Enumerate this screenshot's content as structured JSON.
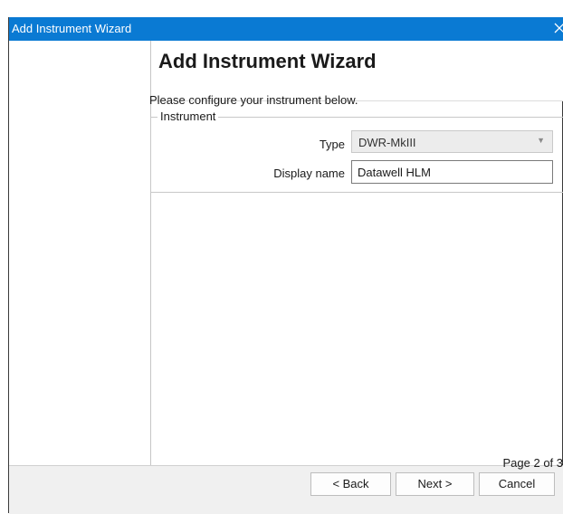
{
  "window": {
    "title": "Add Instrument Wizard",
    "close_glyph": "✕"
  },
  "page": {
    "heading": "Add Instrument Wizard",
    "intro": "Please configure your instrument below.",
    "group_legend": "Instrument",
    "type_label": "Type",
    "type_value": "DWR-MkIII",
    "display_name_label": "Display name",
    "display_name_value": "Datawell HLM",
    "page_indicator": "Page 2 of 3"
  },
  "buttons": {
    "back": "< Back",
    "next": "Next >",
    "cancel": "Cancel"
  },
  "icons": {
    "close": "close-icon",
    "dropdown": "chevron-down-icon"
  },
  "colors": {
    "titlebar": "#0a7ad3",
    "footer": "#f0f0f0"
  }
}
